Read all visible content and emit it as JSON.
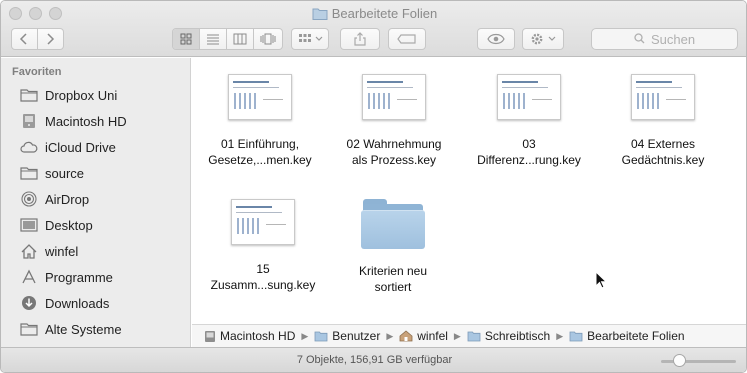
{
  "window": {
    "title": "Bearbeitete Folien"
  },
  "toolbar": {
    "back_icon": "chevron-left-icon",
    "forward_icon": "chevron-right-icon",
    "view_modes": [
      "icon-view-icon",
      "list-view-icon",
      "column-view-icon",
      "coverflow-view-icon"
    ],
    "search_placeholder": "Suchen"
  },
  "sidebar": {
    "heading": "Favoriten",
    "items": [
      {
        "label": "Dropbox Uni",
        "icon": "folder-icon"
      },
      {
        "label": "Macintosh HD",
        "icon": "hard-drive-icon"
      },
      {
        "label": "iCloud Drive",
        "icon": "cloud-icon"
      },
      {
        "label": "source",
        "icon": "folder-icon"
      },
      {
        "label": "AirDrop",
        "icon": "airdrop-icon"
      },
      {
        "label": "Desktop",
        "icon": "desktop-icon"
      },
      {
        "label": "winfel",
        "icon": "home-icon"
      },
      {
        "label": "Programme",
        "icon": "applications-icon"
      },
      {
        "label": "Downloads",
        "icon": "download-icon"
      },
      {
        "label": "Alte Systeme",
        "icon": "folder-icon"
      }
    ]
  },
  "files": [
    {
      "line1": "01 Einführung,",
      "line2": "Gesetze,...men.key"
    },
    {
      "line1": "02 Wahrnehmung",
      "line2": "als Prozess.key"
    },
    {
      "line1": "03",
      "line2": "Differenz...rung.key"
    },
    {
      "line1": "04 Externes",
      "line2": "Gedächtnis.key"
    },
    {
      "line1": "15",
      "line2": "Zusamm...sung.key"
    },
    {
      "line1": "Kriterien neu",
      "line2": "sortiert"
    }
  ],
  "pathbar": [
    "Macintosh HD",
    "Benutzer",
    "winfel",
    "Schreibtisch",
    "Bearbeitete Folien"
  ],
  "status": {
    "text": "7 Objekte, 156,91 GB verfügbar",
    "zoom_fraction": 0.2
  },
  "colors": {
    "folder": "#9fc0de",
    "accent": "#6a86a8"
  }
}
